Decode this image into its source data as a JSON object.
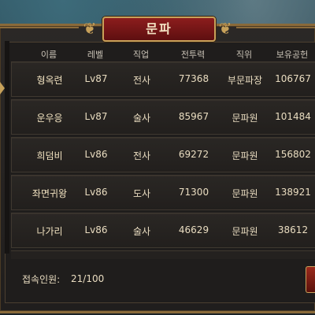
{
  "title": "문파",
  "columns": {
    "name": "이름",
    "level": "레벨",
    "class": "직업",
    "power": "전투력",
    "rank": "직위",
    "contribution": "보유공헌"
  },
  "members": [
    {
      "name": "형옥련",
      "level": "Lv87",
      "class": "전사",
      "power": "77368",
      "rank": "부문파장",
      "contribution": "106767"
    },
    {
      "name": "운우응",
      "level": "Lv87",
      "class": "술사",
      "power": "85967",
      "rank": "문파원",
      "contribution": "101484"
    },
    {
      "name": "희덤비",
      "level": "Lv86",
      "class": "전사",
      "power": "69272",
      "rank": "문파원",
      "contribution": "156802"
    },
    {
      "name": "좌면귀왕",
      "level": "Lv86",
      "class": "도사",
      "power": "71300",
      "rank": "문파원",
      "contribution": "138921"
    },
    {
      "name": "나가리",
      "level": "Lv86",
      "class": "술사",
      "power": "46629",
      "rank": "문파원",
      "contribution": "38612"
    }
  ],
  "footer": {
    "online_label": "접속인원:",
    "online_value": "21/100"
  }
}
